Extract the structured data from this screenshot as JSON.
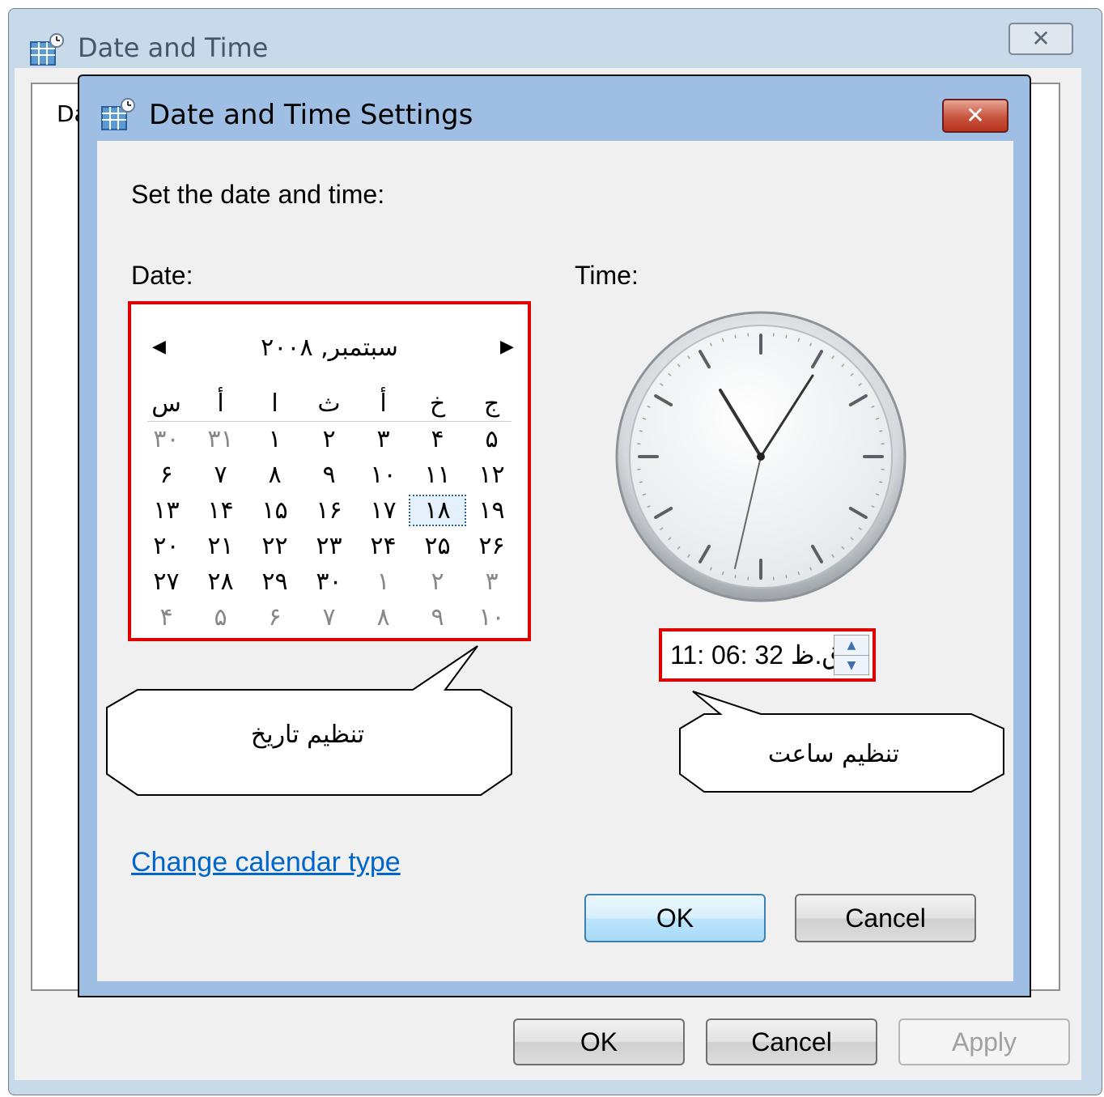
{
  "outer": {
    "title": "Date and Time",
    "tab_fragment": "Da",
    "close_label": "✕",
    "buttons": {
      "ok": "OK",
      "cancel": "Cancel",
      "apply": "Apply"
    }
  },
  "dialog": {
    "title": "Date and Time Settings",
    "close_label": "✕",
    "heading": "Set the date and time:",
    "date_label": "Date:",
    "time_label": "Time:",
    "calendar": {
      "month_title": "سبتمبر, ۲۰۰۸",
      "prev_arrow": "◀",
      "next_arrow": "▶",
      "weekday_headers": [
        "س",
        "أ",
        "ا",
        "ث",
        "أ",
        "خ",
        "ج"
      ],
      "weeks": [
        [
          "۳۰",
          "۳۱",
          "۱",
          "۲",
          "۳",
          "۴",
          "۵"
        ],
        [
          "۶",
          "۷",
          "۸",
          "۹",
          "۱۰",
          "۱۱",
          "۱۲"
        ],
        [
          "۱۳",
          "۱۴",
          "۱۵",
          "۱۶",
          "۱۷",
          "۱۸",
          "۱۹"
        ],
        [
          "۲۰",
          "۲۱",
          "۲۲",
          "۲۳",
          "۲۴",
          "۲۵",
          "۲۶"
        ],
        [
          "۲۷",
          "۲۸",
          "۲۹",
          "۳۰",
          "۱",
          "۲",
          "۳"
        ],
        [
          "۴",
          "۵",
          "۶",
          "۷",
          "۸",
          "۹",
          "۱۰"
        ]
      ],
      "selected_day": "۱۸"
    },
    "time_value": "11: 06: 32 ق.ظ",
    "spin_up": "▲",
    "spin_down": "▼",
    "callout_date": "تنظیم تاریخ",
    "callout_time": "تنظیم ساعت",
    "link": "Change calendar type",
    "ok": "OK",
    "cancel": "Cancel"
  },
  "icons": {
    "window_icon": "calendar-clock-icon",
    "close": "close-icon"
  },
  "colors": {
    "highlight_border": "#e00000",
    "link": "#0066cc",
    "title_bar": "#9ebfe3"
  }
}
